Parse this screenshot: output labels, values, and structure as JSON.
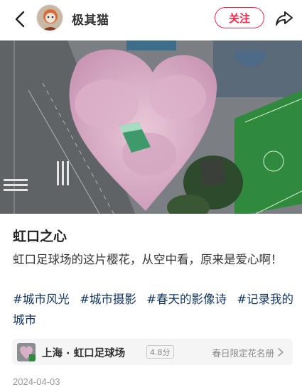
{
  "header": {
    "author_name": "极其猫",
    "follow_label": "关注"
  },
  "post": {
    "title": "虹口之心",
    "body": "虹口足球场的这片樱花，从空中看，原来是爱心啊！",
    "tags": [
      "#城市风光",
      "#城市摄影",
      "#春天的影像诗",
      "#记录我的城市"
    ],
    "date": "2024-04-03"
  },
  "location": {
    "name": "上海 · 虹口足球场",
    "score": "4.8分",
    "rank_label": "春日限定花名册"
  },
  "colors": {
    "accent": "#ff2442",
    "tag": "#133667",
    "meta": "#999999"
  },
  "icons": {
    "back": "chevron-left-icon",
    "share": "share-icon",
    "chevron": "chevron-right-icon"
  }
}
